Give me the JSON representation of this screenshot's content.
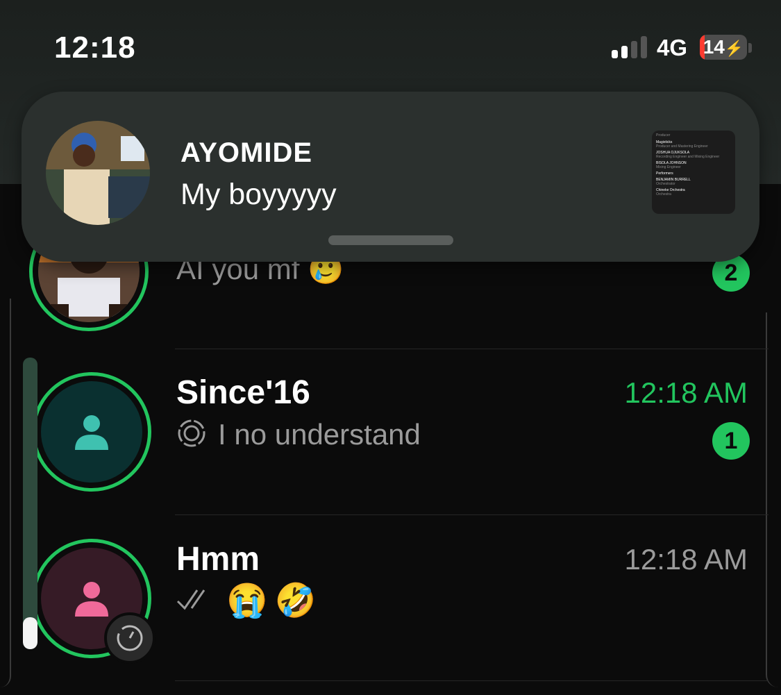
{
  "status_bar": {
    "time": "12:18",
    "network": "4G",
    "battery": "14",
    "charging_icon": "bolt-icon"
  },
  "notification": {
    "sender": "AYOMIDE",
    "message": "My boyyyyy",
    "thumbnail_lines": [
      "Producer",
      "Magixticks",
      "Producer and Mastering Engineer",
      "JOSHUA OJUKSOLA",
      "Recording Engineer and Mixing Engineer",
      "BISOLA JOHNSON",
      "Mixing Engineer",
      "Performers",
      "BENJAMIN BURRELL",
      "Orchestrator",
      "Chineke Orchestra",
      "Orchestra"
    ]
  },
  "chats": [
    {
      "name": "",
      "preview": "AI you mf 🥲",
      "time": "",
      "unread": "2"
    },
    {
      "name": "Since'16",
      "preview": "I no understand",
      "preview_icon": "broadcast-icon",
      "time": "12:18 AM",
      "unread": "1"
    },
    {
      "name": "Hmm",
      "preview": "😭🤣",
      "preview_icon": "double-check-icon",
      "time": "12:18 AM",
      "unread": ""
    }
  ],
  "colors": {
    "accent": "#22c55e",
    "teal_avatar": "#0a3030",
    "pink_avatar": "#361b26"
  }
}
